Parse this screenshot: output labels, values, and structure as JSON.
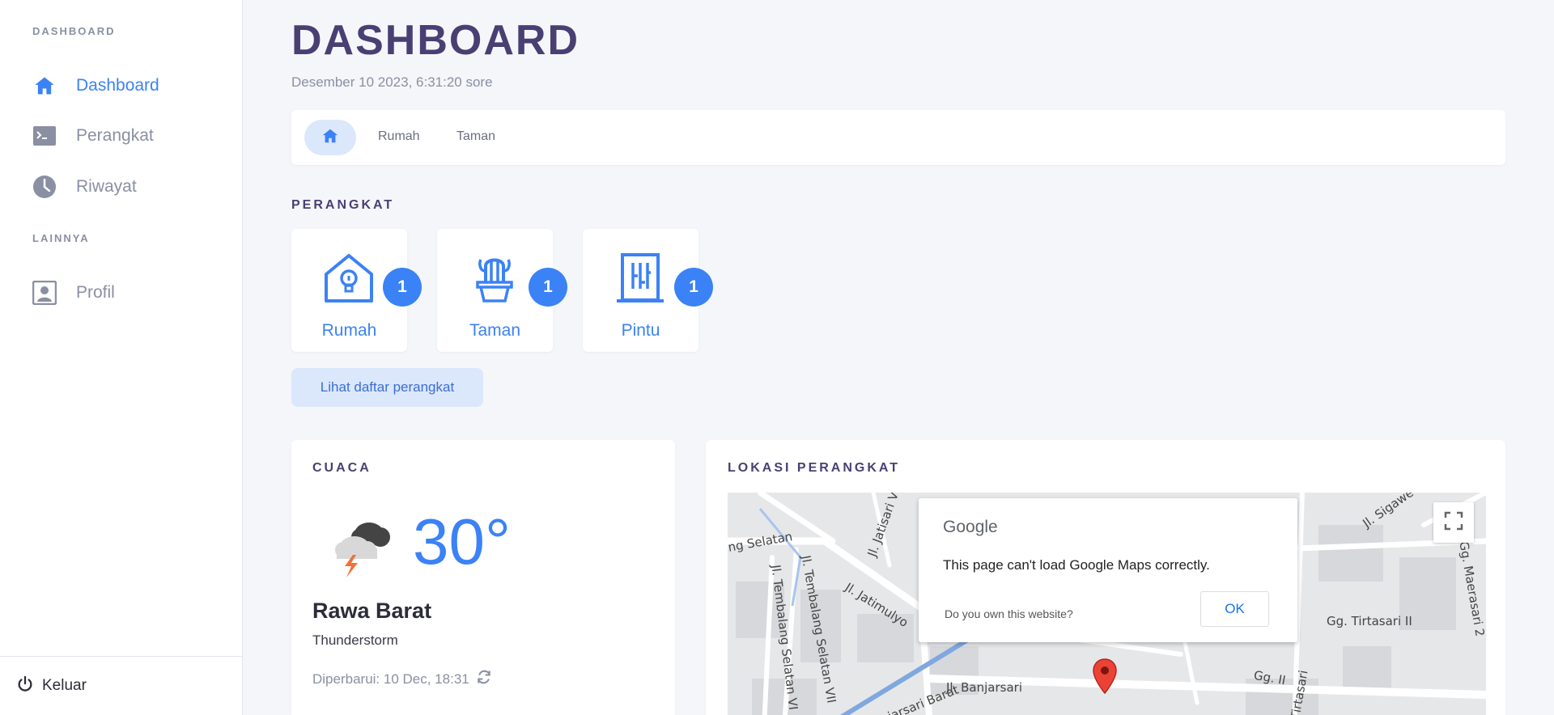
{
  "sidebar": {
    "section_main": "DASHBOARD",
    "section_other": "LAINNYA",
    "items": [
      {
        "label": "Dashboard",
        "icon": "home-icon",
        "active": true
      },
      {
        "label": "Perangkat",
        "icon": "terminal-icon",
        "active": false
      },
      {
        "label": "Riwayat",
        "icon": "clock-icon",
        "active": false
      },
      {
        "label": "Profil",
        "icon": "profile-icon",
        "active": false
      }
    ],
    "logout_label": "Keluar"
  },
  "header": {
    "title": "DASHBOARD",
    "datetime": "Desember 10 2023, 6:31:20 sore"
  },
  "tabs": [
    {
      "label": "Rumah"
    },
    {
      "label": "Taman"
    }
  ],
  "devices": {
    "section_label": "PERANGKAT",
    "items": [
      {
        "label": "Rumah",
        "count": "1",
        "icon": "smart-home-icon"
      },
      {
        "label": "Taman",
        "count": "1",
        "icon": "cactus-icon"
      },
      {
        "label": "Pintu",
        "count": "1",
        "icon": "door-icon"
      }
    ],
    "list_button": "Lihat daftar perangkat"
  },
  "weather": {
    "section_label": "CUACA",
    "temperature": "30°",
    "location": "Rawa Barat",
    "condition": "Thunderstorm",
    "updated": "Diperbarui: 10 Dec, 18:31",
    "icon": "thunderstorm-icon"
  },
  "map": {
    "section_label": "LOKASI PERANGKAT",
    "dialog_logo": "Google",
    "dialog_message": "This page can't load Google Maps correctly.",
    "dialog_question": "Do you own this website?",
    "dialog_ok": "OK",
    "streets": [
      "Jl. Banjarsari",
      "Jl. Jatimulyo",
      "Jl. Jatisari V",
      "Jl. Tembalang Selatan VII",
      "Jl. Tembalang Selatan VI",
      "Gg. Tirtasari II",
      "Gg. II",
      "Jl. Tirtasari",
      "Gg. Maerasari 2",
      "Jl. Sigawe",
      "Jl. Banjarsari Barat",
      "ng Selatan"
    ]
  },
  "colors": {
    "accent": "#3b82f6",
    "title": "#4a3f73",
    "muted": "#8a8fa3"
  }
}
